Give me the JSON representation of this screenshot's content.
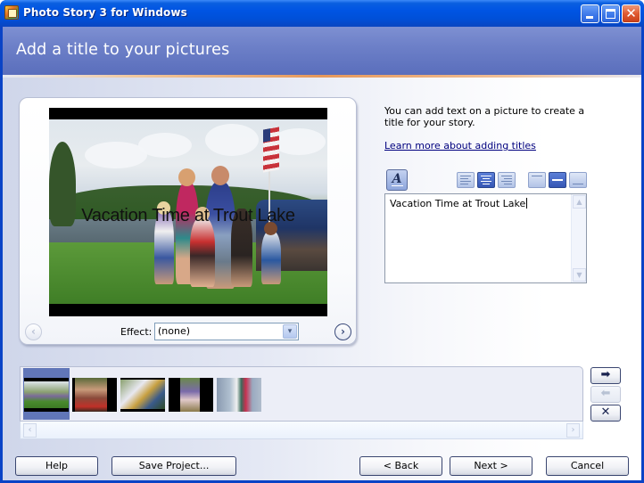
{
  "window": {
    "title": "Photo Story 3 for Windows",
    "controls": {
      "minimize": "minimize",
      "maximize": "maximize",
      "close": "✕"
    }
  },
  "header": {
    "title": "Add a title to your pictures"
  },
  "preview": {
    "overlay_text": "Vacation Time at Trout Lake",
    "effect_label": "Effect:",
    "effect_value": "(none)",
    "prev_icon": "‹",
    "next_icon": "›",
    "dropdown_icon": "▾"
  },
  "side": {
    "description": "You can add text on a picture to create a title for your story.",
    "learn_link": "Learn more about adding titles",
    "font_button_glyph": "A",
    "horizontal_alignment": {
      "options": [
        "left",
        "center",
        "right"
      ],
      "selected": "center"
    },
    "vertical_alignment": {
      "options": [
        "top",
        "middle",
        "bottom"
      ],
      "selected": "middle"
    },
    "title_text": "Vacation Time at Trout Lake"
  },
  "filmstrip": {
    "selected_index": 0,
    "thumbnails": [
      {
        "label": "family at lake"
      },
      {
        "label": "group portrait"
      },
      {
        "label": "man with umbrella"
      },
      {
        "label": "person standing"
      },
      {
        "label": "two people at house"
      }
    ],
    "scroll_left_icon": "‹",
    "scroll_right_icon": "›"
  },
  "side_buttons": {
    "move_right_icon": "➡",
    "move_left_icon": "⬅",
    "remove_icon": "✕"
  },
  "footer": {
    "help": "Help",
    "save_project": "Save Project...",
    "back": "< Back",
    "next": "Next >",
    "cancel": "Cancel"
  }
}
